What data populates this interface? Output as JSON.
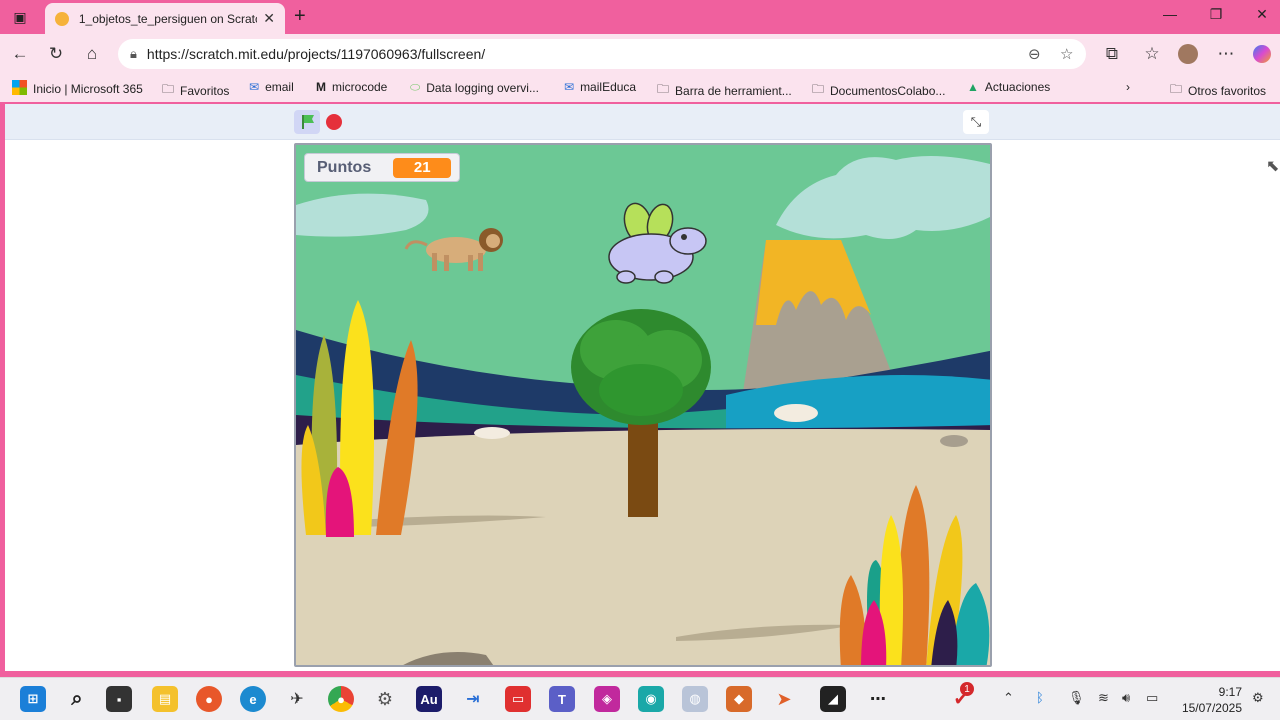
{
  "browser": {
    "tab_title": "1_objetos_te_persiguen on Scratch",
    "url": "https://scratch.mit.edu/projects/1197060963/fullscreen/",
    "bookmarks": [
      {
        "label": "Inicio | Microsoft 365",
        "icon": "microsoft-icon"
      },
      {
        "label": "Favoritos",
        "icon": "folder-icon"
      },
      {
        "label": "email",
        "icon": "mail-icon"
      },
      {
        "label": "microcode",
        "icon": "microcode-icon"
      },
      {
        "label": "Data logging overvi...",
        "icon": "link-icon"
      },
      {
        "label": "mailEduca",
        "icon": "mail-icon"
      },
      {
        "label": "Barra de herramient...",
        "icon": "folder-icon"
      },
      {
        "label": "DocumentosColabo...",
        "icon": "folder-icon"
      },
      {
        "label": "Actuaciones",
        "icon": "drive-icon"
      },
      {
        "label": "Otros favoritos",
        "icon": "folder-icon"
      }
    ]
  },
  "scratch": {
    "monitor_label": "Puntos",
    "monitor_value": "21"
  },
  "taskbar": {
    "time": "9:17",
    "date": "15/07/2025",
    "notification_count": "1"
  },
  "colors": {
    "tab_strip": "#f0609e",
    "toolbar": "#fbe3ee",
    "monitor_value_bg": "#fe8c1a"
  }
}
